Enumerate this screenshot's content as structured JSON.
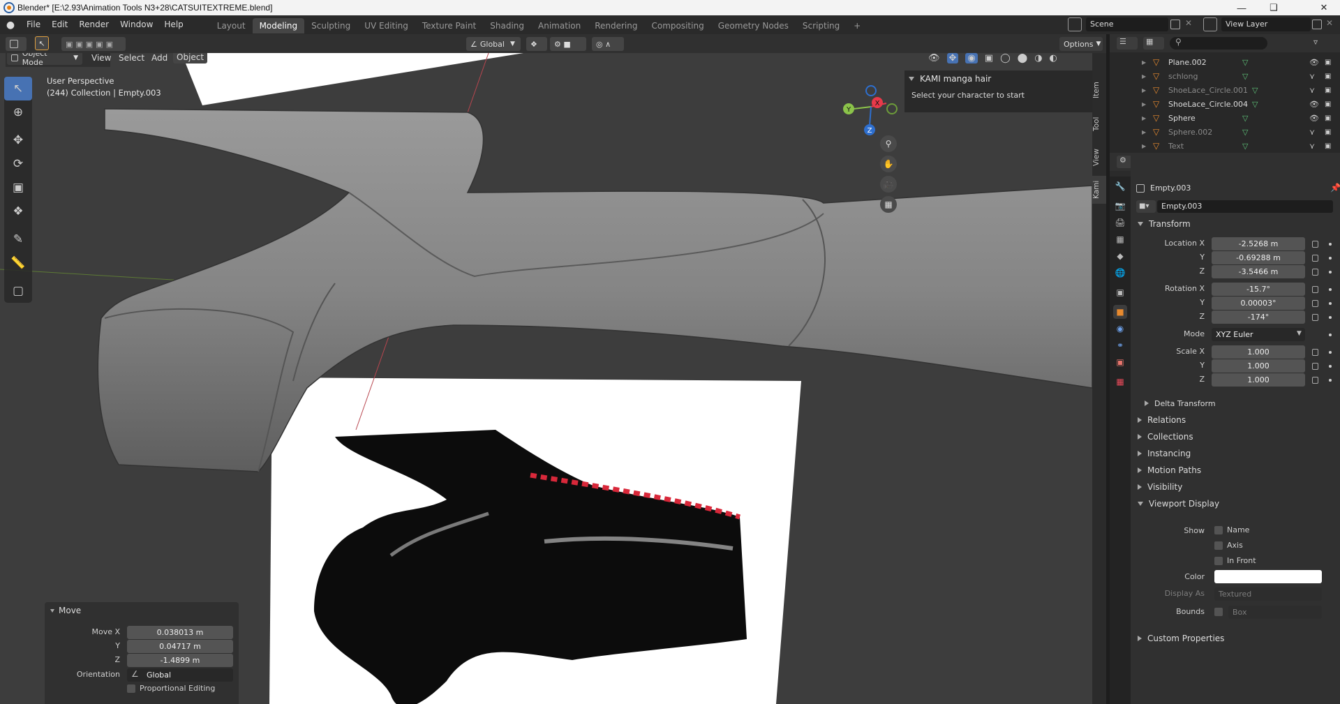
{
  "window": {
    "title": "Blender* [E:\\2.93\\Animation Tools N3+28\\CATSUITEXTREME.blend]"
  },
  "menus": [
    "File",
    "Edit",
    "Render",
    "Window",
    "Help"
  ],
  "workspaces": [
    "Layout",
    "Modeling",
    "Sculpting",
    "UV Editing",
    "Texture Paint",
    "Shading",
    "Animation",
    "Rendering",
    "Compositing",
    "Geometry Nodes",
    "Scripting"
  ],
  "active_workspace": "Modeling",
  "scene": {
    "scene_name": "Scene",
    "view_layer": "View Layer"
  },
  "viewport_header": {
    "mode": "Object Mode",
    "menus": [
      "View",
      "Select",
      "Add",
      "Object"
    ],
    "orientation": "Global",
    "options_label": "Options"
  },
  "viewport": {
    "perspective_label": "User Perspective",
    "collection_label": "(244) Collection | Empty.003",
    "gizmo": {
      "x": "X",
      "y": "Y",
      "z": "Z"
    }
  },
  "npanel": {
    "title": "KAMI manga hair",
    "message": "Select your character to start"
  },
  "side_tabs": [
    "Item",
    "Tool",
    "View",
    "Kami"
  ],
  "outliner": {
    "items": [
      {
        "name": "Plane.002",
        "dim": false
      },
      {
        "name": "schlong",
        "dim": true
      },
      {
        "name": "ShoeLace_Circle.001",
        "dim": true
      },
      {
        "name": "ShoeLace_Circle.004",
        "dim": false
      },
      {
        "name": "Sphere",
        "dim": false
      },
      {
        "name": "Sphere.002",
        "dim": true
      },
      {
        "name": "Text",
        "dim": true
      }
    ]
  },
  "properties": {
    "object_name": "Empty.003",
    "data_name": "Empty.003",
    "transform": {
      "title": "Transform",
      "location_label": "Location X",
      "location": [
        "-2.5268 m",
        "-0.69288 m",
        "-3.5466 m"
      ],
      "rotation_label": "Rotation X",
      "rotation": [
        "-15.7°",
        "0.00003°",
        "-174°"
      ],
      "mode_label": "Mode",
      "mode": "XYZ Euler",
      "scale_label": "Scale X",
      "scale": [
        "1.000",
        "1.000",
        "1.000"
      ],
      "axis_y": "Y",
      "axis_z": "Z",
      "delta": "Delta Transform"
    },
    "sections": [
      "Relations",
      "Collections",
      "Instancing",
      "Motion Paths",
      "Visibility"
    ],
    "viewport_display": {
      "title": "Viewport Display",
      "show_label": "Show",
      "name": "Name",
      "axis": "Axis",
      "in_front": "In Front",
      "color_label": "Color",
      "color": "#ffffff",
      "display_as_label": "Display As",
      "display_as": "Textured",
      "bounds_label": "Bounds",
      "bounds": "Box"
    },
    "custom_properties": "Custom Properties"
  },
  "move_panel": {
    "title": "Move",
    "move_x_label": "Move X",
    "values": [
      "0.038013 m",
      "0.04717 m",
      "-1.4899 m"
    ],
    "y": "Y",
    "z": "Z",
    "orientation_label": "Orientation",
    "orientation": "Global",
    "proportional": "Proportional Editing"
  },
  "colors": {
    "accent": "#4772b3",
    "x_axis": "#e8394a",
    "y_axis": "#8bc34a",
    "z_axis": "#2e6fcf"
  }
}
